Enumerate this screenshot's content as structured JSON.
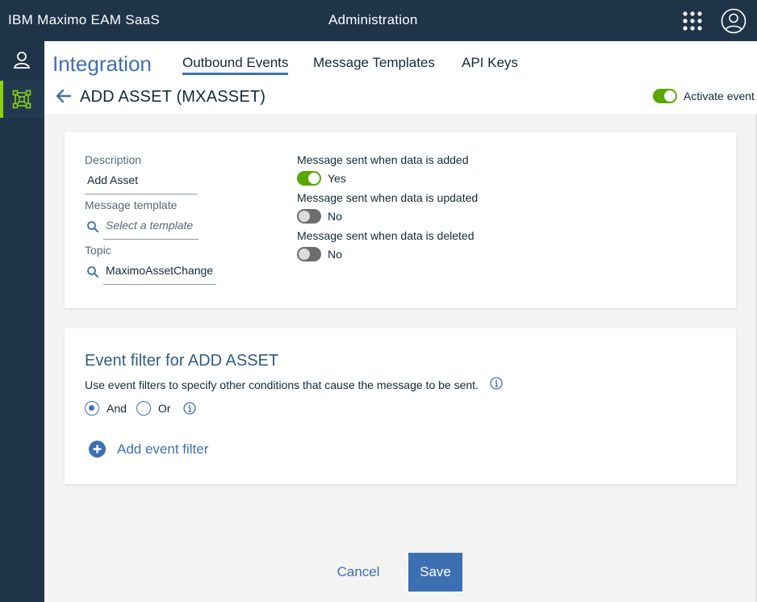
{
  "topbar": {
    "brand": "IBM Maximo EAM SaaS",
    "section": "Administration",
    "apps_icon": "app-switcher-grid-icon",
    "user_icon": "user-avatar-icon"
  },
  "sidebar": {
    "items": [
      {
        "name": "user",
        "icon": "user-icon",
        "active": false
      },
      {
        "name": "integration",
        "icon": "integration-network-icon",
        "active": true
      }
    ]
  },
  "page": {
    "title": "Integration",
    "tabs": [
      {
        "label": "Outbound Events",
        "active": true
      },
      {
        "label": "Message Templates",
        "active": false
      },
      {
        "label": "API Keys",
        "active": false
      }
    ],
    "record_title": "ADD ASSET (MXASSET)",
    "activate_label": "Activate event",
    "activate_on": true
  },
  "details": {
    "description_label": "Description",
    "description_value": "Add Asset",
    "template_label": "Message template",
    "template_placeholder": "Select a template",
    "topic_label": "Topic",
    "topic_value": "MaximoAssetChange",
    "toggles": [
      {
        "label": "Message sent when data is added",
        "value": "Yes",
        "on": true
      },
      {
        "label": "Message sent when data is updated",
        "value": "No",
        "on": false
      },
      {
        "label": "Message sent when data is deleted",
        "value": "No",
        "on": false
      }
    ]
  },
  "filter": {
    "title": "Event filter for ADD ASSET",
    "description": "Use event filters to specify other conditions that cause the message to be sent.",
    "and_label": "And",
    "or_label": "Or",
    "selected": "And",
    "add_label": "Add event filter"
  },
  "footer": {
    "cancel_label": "Cancel",
    "save_label": "Save"
  },
  "colors": {
    "nav_bg": "#1f3448",
    "accent": "#3d70b2",
    "toggle_on": "#5aa700",
    "active_indicator": "#8cd211"
  }
}
